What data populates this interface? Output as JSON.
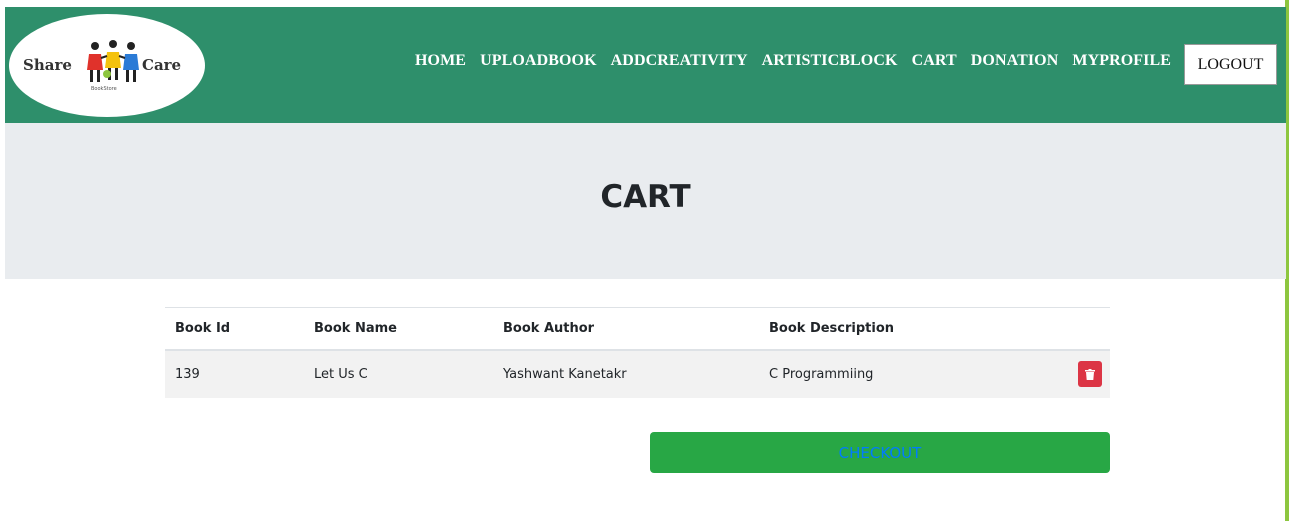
{
  "logo": {
    "left_text": "Share",
    "right_text": "Care",
    "subtitle": "BookStore"
  },
  "nav": {
    "links": [
      "HOME",
      "UPLOADBOOK",
      "ADDCREATIVITY",
      "ARTISTICBLOCK",
      "CART",
      "DONATION",
      "MYPROFILE"
    ],
    "logout_label": "LOGOUT"
  },
  "hero": {
    "title": "CART"
  },
  "table": {
    "headers": [
      "Book Id",
      "Book Name",
      "Book Author",
      "Book Description"
    ],
    "rows": [
      {
        "id": "139",
        "name": "Let Us C",
        "author": "Yashwant Kanetakr",
        "description": "C Programmiing"
      }
    ]
  },
  "checkout_label": "CHECKOUT",
  "colors": {
    "navbar": "#2e8f6b",
    "hero": "#e9ecef",
    "checkout": "#28a745",
    "delete": "#dc3545"
  },
  "icons": {
    "delete": "trash-icon"
  }
}
